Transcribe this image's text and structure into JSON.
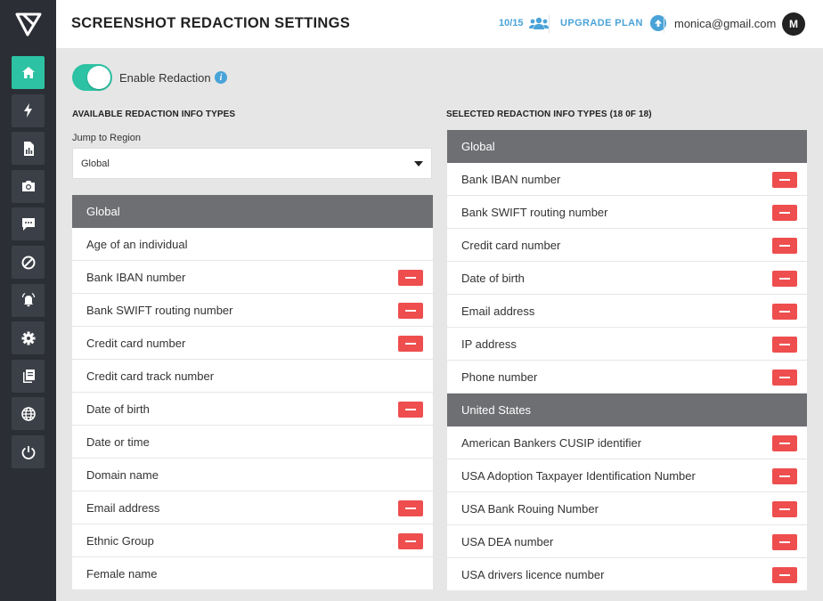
{
  "header": {
    "title": "SCREENSHOT REDACTION SETTINGS",
    "usage": "10/15",
    "upgrade_label": "UPGRADE PLAN",
    "email": "monica@gmail.com",
    "avatar_initial": "M"
  },
  "sidebar": {
    "items": [
      {
        "icon": "home-icon",
        "active": true
      },
      {
        "icon": "lightning-icon",
        "active": false
      },
      {
        "icon": "report-icon",
        "active": false
      },
      {
        "icon": "camera-icon",
        "active": false
      },
      {
        "icon": "chat-icon",
        "active": false
      },
      {
        "icon": "block-icon",
        "active": false
      },
      {
        "icon": "alarm-icon",
        "active": false
      },
      {
        "icon": "gear-icon",
        "active": false
      },
      {
        "icon": "documents-icon",
        "active": false
      },
      {
        "icon": "globe-icon",
        "active": false
      },
      {
        "icon": "power-icon",
        "active": false
      }
    ]
  },
  "redaction": {
    "toggle_label": "Enable Redaction",
    "enabled": true,
    "info_glyph": "i"
  },
  "available": {
    "heading": "AVAILABLE REDACTION INFO TYPES",
    "jump_label": "Jump to Region",
    "region_selected": "Global",
    "group_title": "Global",
    "items": [
      {
        "label": "Age of an individual",
        "selected": false
      },
      {
        "label": "Bank IBAN number",
        "selected": true
      },
      {
        "label": "Bank SWIFT routing number",
        "selected": true
      },
      {
        "label": "Credit card number",
        "selected": true
      },
      {
        "label": "Credit card track number",
        "selected": false
      },
      {
        "label": "Date of birth",
        "selected": true
      },
      {
        "label": "Date or time",
        "selected": false
      },
      {
        "label": "Domain name",
        "selected": false
      },
      {
        "label": "Email address",
        "selected": true
      },
      {
        "label": "Ethnic Group",
        "selected": true
      },
      {
        "label": "Female name",
        "selected": false
      }
    ]
  },
  "selected": {
    "heading": "SELECTED REDACTION INFO TYPES (18 0F 18)",
    "groups": [
      {
        "title": "Global",
        "items": [
          "Bank IBAN number",
          "Bank SWIFT routing number",
          "Credit card number",
          "Date of birth",
          "Email address",
          "IP address",
          "Phone number"
        ]
      },
      {
        "title": "United States",
        "items": [
          "American Bankers CUSIP identifier",
          "USA Adoption Taxpayer Identification Number",
          "USA Bank Rouing Number",
          "USA DEA number",
          "USA drivers licence number"
        ]
      }
    ]
  },
  "colors": {
    "accent": "#2cc2a3",
    "link": "#4aa3d8",
    "remove": "#ee4e4e",
    "sidebar": "#2b2e35",
    "group_header": "#6d6f72"
  }
}
